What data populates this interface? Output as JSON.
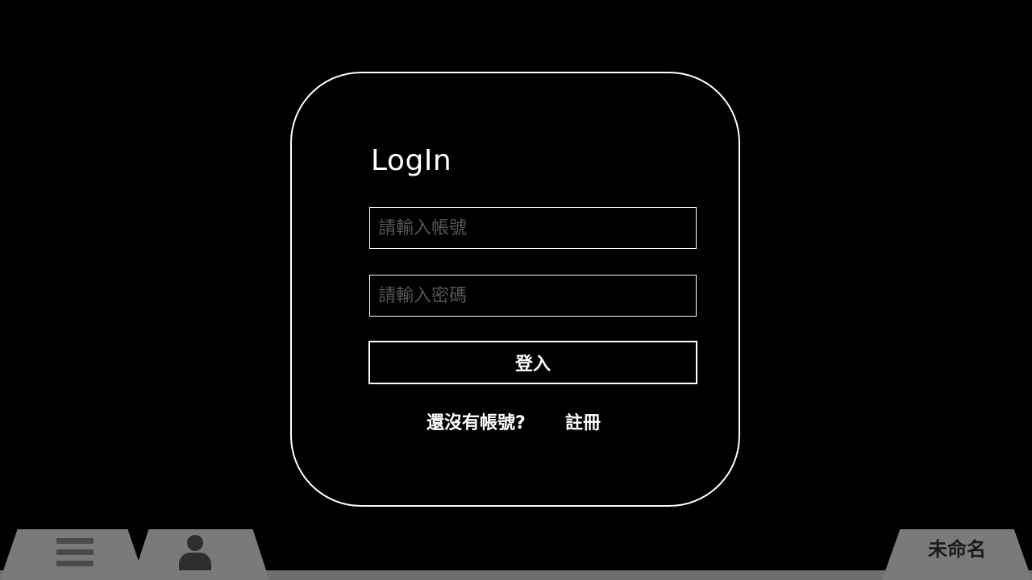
{
  "login": {
    "title": "LogIn",
    "account_placeholder": "請輸入帳號",
    "password_placeholder": "請輸入密碼",
    "submit_label": "登入",
    "register_prompt": "還沒有帳號?",
    "register_link": "註冊"
  },
  "bottom_bar": {
    "menu_icon": "hamburger-menu-icon",
    "profile_icon": "user-icon",
    "name_label": "未命名"
  },
  "colors": {
    "background": "#000000",
    "foreground": "#ffffff",
    "placeholder": "#555555",
    "tab": "#7a7a7a",
    "icon": "#4a4a4a"
  }
}
